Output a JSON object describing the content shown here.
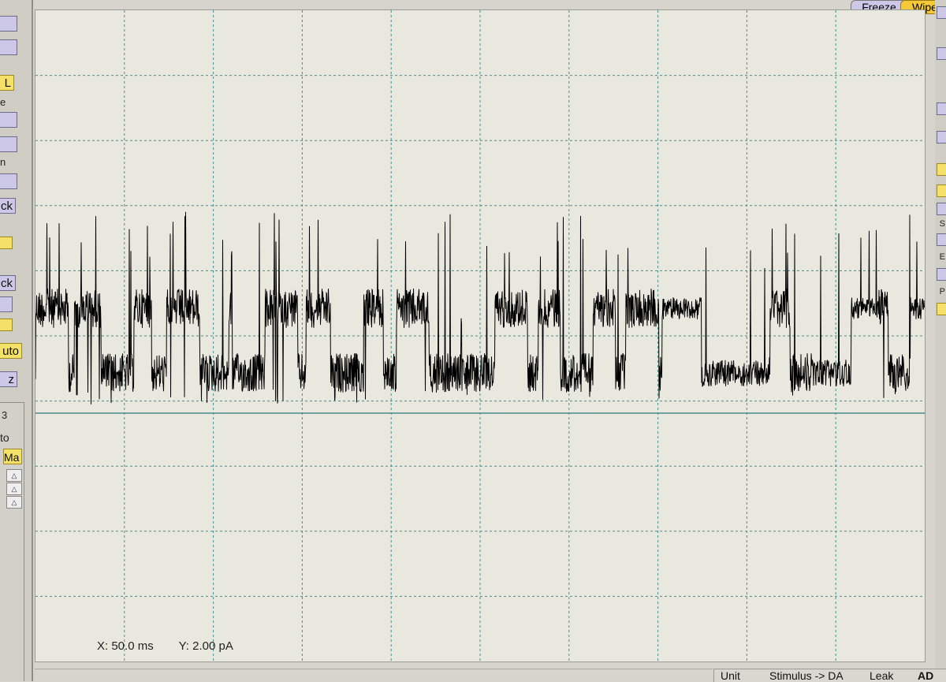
{
  "toolbar": {
    "freeze_label": "Freeze",
    "wipe_label": "Wipe"
  },
  "left_panel": {
    "buttons": [
      "L",
      "ck",
      "ck",
      "uto",
      "z"
    ],
    "text_fragments": [
      "e",
      "n",
      "3",
      "to",
      "Ma"
    ]
  },
  "right_panel": {
    "text_fragments": [
      "S",
      "E",
      "P"
    ]
  },
  "cursor_readout": {
    "x": "X: 50.0 ms",
    "y": "Y: 2.00 pA"
  },
  "status_bar": {
    "tabs": [
      "Unit",
      "Stimulus -> DA",
      "Leak",
      "AD"
    ]
  },
  "trace": {
    "color": "#000000",
    "baseline_color": "#4a8a8a",
    "grid_color": "#3f8f8f",
    "grid_columns": 10,
    "grid_rows": 10
  }
}
